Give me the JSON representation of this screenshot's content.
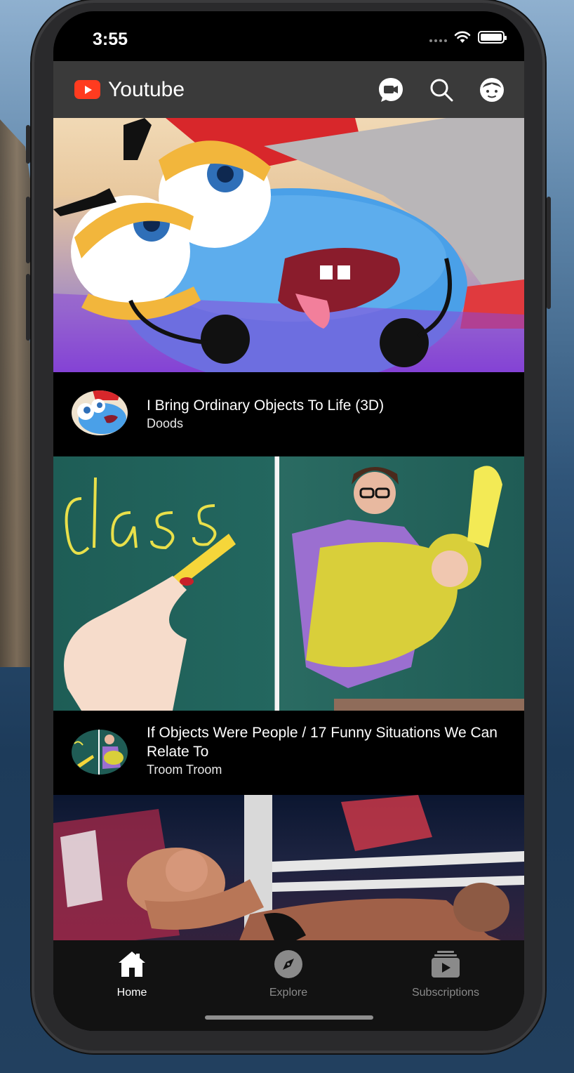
{
  "status_bar": {
    "time": "3:55"
  },
  "app_bar": {
    "title": "Youtube",
    "actions": [
      {
        "icon": "video-camera-icon"
      },
      {
        "icon": "search-icon"
      },
      {
        "icon": "account-icon"
      }
    ]
  },
  "videos": [
    {
      "title": "I Bring Ordinary Objects To Life (3D)",
      "channel": "Doods"
    },
    {
      "title": "If Objects Were People / 17 Funny Situations We Can Relate To",
      "channel": "Troom Troom"
    }
  ],
  "tabs": [
    {
      "label": "Home",
      "icon": "home-icon",
      "active": true
    },
    {
      "label": "Explore",
      "icon": "compass-icon",
      "active": false
    },
    {
      "label": "Subscriptions",
      "icon": "subscriptions-icon",
      "active": false
    }
  ],
  "colors": {
    "brand_red": "#ff3b1f",
    "app_bar_bg": "#3a3a3a",
    "tab_active": "#ffffff",
    "tab_inactive": "#8a8a8a"
  }
}
